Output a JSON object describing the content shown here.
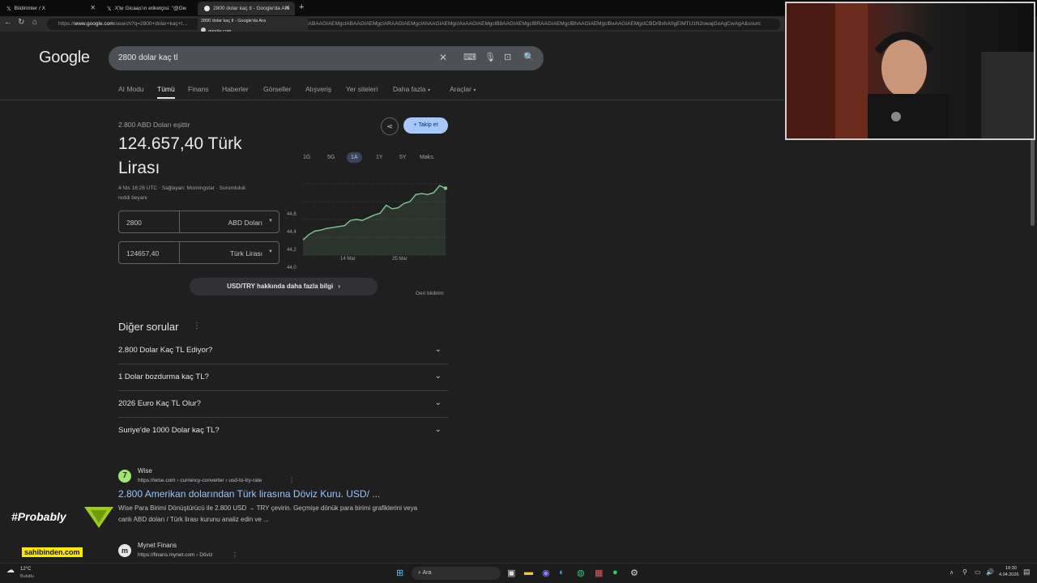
{
  "browser": {
    "tabs": [
      {
        "label": "Bildirimler / X",
        "close": "✕"
      },
      {
        "label": "X'te Gicaas'ın etiketçisi: \"@Gergin…",
        "close": "✕"
      },
      {
        "label": "2800 dolar kaç tl - Google'da Ara",
        "close": "✕"
      }
    ],
    "new_tab": "+",
    "url_prefix": "https://",
    "url_host": "www.google.com",
    "url_rest": "/search?q=2800+dolar+kaç+t…",
    "url_tail": "KgclABAAGIAEMgclABAAGIAEMgclARAAGIAEMgclAhAAGIAEMgclAxAAGIAEMgclB8AAGIAEMgclBRAAGIAEMgclBhAAGIAEMgclBxAAGIAEMgclCBDrBxhA0gEIMTU1N2owajGoAgCwAgA&sourc",
    "hovercard_title": "2800 dolar kaç tl - Google'da Ara",
    "hovercard_host": "google.com"
  },
  "google": {
    "logo": "Google",
    "query": "2800 dolar kaç tl",
    "nav_tabs": [
      "AI Modu",
      "Tümü",
      "Finans",
      "Haberler",
      "Görseller",
      "Alışveriş",
      "Yer siteleri",
      "Daha fazla",
      "Araçlar"
    ]
  },
  "currency": {
    "subtitle": "2.800 ABD Doları eşittir",
    "result_line1": "124.657,40 Türk",
    "result_line2": "Lirası",
    "meta_line1": "4 Nis 16:26 UTC · Sağlayan: Morningstar · Sorumluluk",
    "meta_line2": "reddi beyanı",
    "share": "share-icon",
    "follow": "Takip et",
    "from_value": "2800",
    "from_currency": "ABD Doları",
    "to_value": "124657,40",
    "to_currency": "Türk Lirası",
    "more_info": "USD/TRY hakkında daha fazla bilgi",
    "feedback": "Geri bildirim",
    "ranges": [
      "1G",
      "5G",
      "1A",
      "1Y",
      "5Y",
      "Maks."
    ],
    "active_range": "1A"
  },
  "chart_data": {
    "type": "area",
    "y_ticks": [
      "44,6",
      "44,4",
      "44,2",
      "44,0",
      "43,8"
    ],
    "ylim": [
      43.8,
      44.6
    ],
    "x_ticks": [
      "14 Mar",
      "25 Mar"
    ],
    "values": [
      43.97,
      44.03,
      44.07,
      44.08,
      44.1,
      44.11,
      44.12,
      44.13,
      44.19,
      44.2,
      44.19,
      44.22,
      44.25,
      44.27,
      44.36,
      44.32,
      44.33,
      44.38,
      44.4,
      44.48,
      44.49,
      44.48,
      44.5,
      44.58,
      44.55
    ],
    "color": "#81c995"
  },
  "other_questions": {
    "title": "Diğer sorular",
    "items": [
      "2.800 Dolar Kaç TL Ediyor?",
      "1 Dolar bozdurma kaç TL?",
      "2026 Euro Kaç TL Olur?",
      "Suriye'de 1000 Dolar kaç TL?"
    ]
  },
  "results": [
    {
      "site": "Wise",
      "url": "https://wise.com › currency-converter › usd-to-try-rate",
      "title": "2.800 Amerikan dolarından Türk lirasına Döviz Kuru. USD/ ...",
      "snippet_line1": "Wise Para Birimi Dönüştürücü ile 2.800 USD → TRY çevirin. Geçmişe dönük para birimi grafiklerini veya",
      "snippet_line2": "canlı ABD doları / Türk lirası kurunu analiz edin ve ..."
    },
    {
      "site": "Mynet Finans",
      "url": "https://finans.mynet.com › Döviz"
    }
  ],
  "overlay": {
    "probably": "#Probably",
    "sahibinden": "sahibinden.com"
  },
  "taskbar": {
    "weather_temp": "12°C",
    "weather_desc": "Bulutlu",
    "search_label": "Ara",
    "time": "19:30",
    "date": "4.04.2026"
  }
}
